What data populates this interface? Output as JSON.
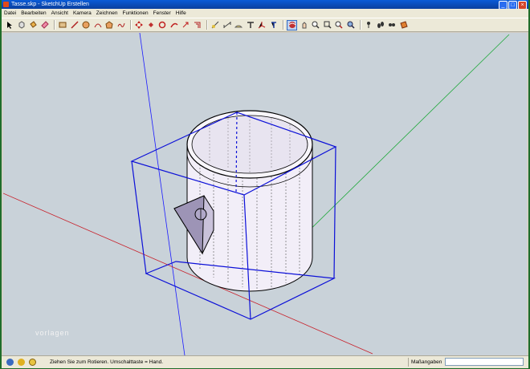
{
  "window": {
    "title": "Tasse.skp - SketchUp Erstellen"
  },
  "menu": [
    "Datei",
    "Bearbeiten",
    "Ansicht",
    "Kamera",
    "Zeichnen",
    "Funktionen",
    "Fenster",
    "Hilfe"
  ],
  "toolbar_icons": [
    "select-icon",
    "component-icon",
    "paint-bucket-icon",
    "eraser-icon",
    "rectangle-icon",
    "line-icon",
    "circle-icon",
    "arc-icon",
    "polygon-icon",
    "freehand-icon",
    "move-icon",
    "push-pull-icon",
    "rotate-icon",
    "follow-me-icon",
    "scale-icon",
    "offset-icon",
    "tape-measure-icon",
    "dimension-icon",
    "protractor-icon",
    "text-icon",
    "axes-icon",
    "3d-text-icon",
    "orbit-icon",
    "pan-icon",
    "zoom-icon",
    "zoom-window-icon",
    "zoom-extents-icon",
    "previous-icon",
    "position-camera-icon",
    "walk-icon",
    "look-around-icon",
    "section-plane-icon"
  ],
  "active_tool": "orbit-icon",
  "viewport": {
    "watermark": "vorlagen"
  },
  "status": {
    "text": "Ziehen Sie zum Rotieren. Umschalttaste = Hand.",
    "measure_label": "Maßangaben",
    "measure_value": ""
  }
}
